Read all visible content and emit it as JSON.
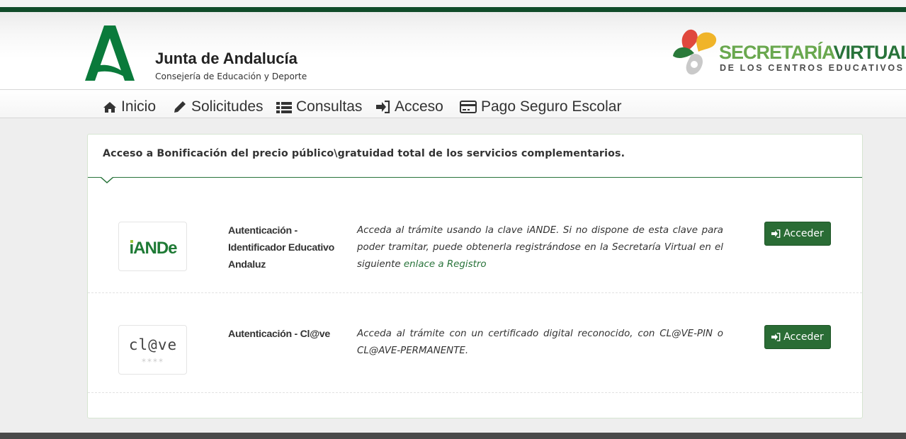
{
  "header": {
    "org_title": "Junta de Andalucía",
    "org_subtitle": "Consejería de Educación y Deporte",
    "app_title_part1": "SECRETARÍA",
    "app_title_part2": "VIRTUAL",
    "app_subtitle": "DE LOS CENTROS EDUCATIVOS"
  },
  "nav": [
    {
      "label": "Inicio",
      "icon": "home-icon"
    },
    {
      "label": "Solicitudes",
      "icon": "pencil-icon"
    },
    {
      "label": "Consultas",
      "icon": "list-icon"
    },
    {
      "label": "Acceso",
      "icon": "sign-in-icon"
    },
    {
      "label": "Pago Seguro Escolar",
      "icon": "credit-card-icon"
    }
  ],
  "panel": {
    "title": "Acceso a Bonificación del precio público\\gratuidad total de los servicios complementarios."
  },
  "methods": [
    {
      "logo_text": "iANDe",
      "title": "Autenticación - Identificador Educativo Andaluz",
      "description": "Acceda al trámite usando la clave iANDE. Si no dispone de esta clave para poder tramitar, puede obtenerla registrándose en la Secretaría Virtual en el siguiente",
      "link": "enlace a Registro",
      "button": "Acceder"
    },
    {
      "logo_text": "cl@ve",
      "logo_stars": "****",
      "title": "Autenticación - Cl@ve",
      "description": "Acceda al trámite con un certificado digital reconocido, con CL@VE-PIN o CL@AVE-PERMANENTE.",
      "button": "Acceder"
    }
  ],
  "colors": {
    "brand_dark_green": "#114c2a",
    "brand_green": "#28733a",
    "light_green": "#6aa84f",
    "button_green": "#2a6c35"
  }
}
